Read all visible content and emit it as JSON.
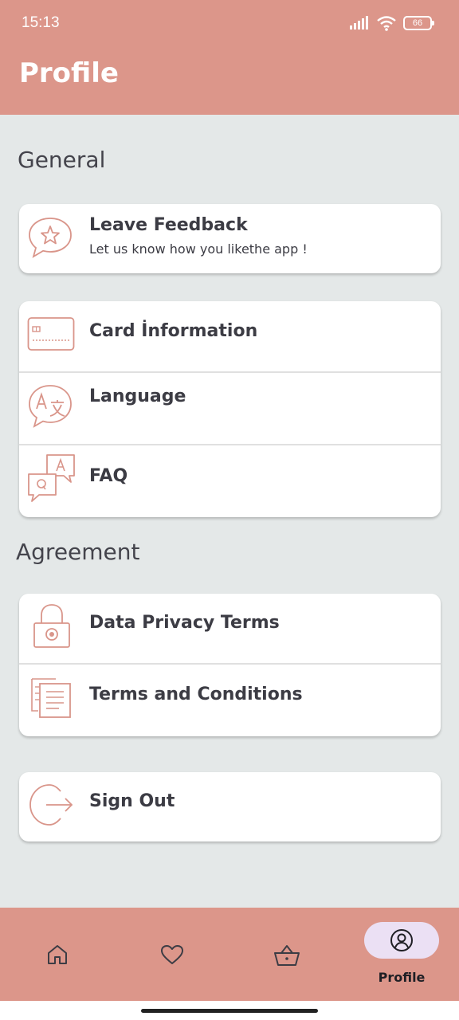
{
  "status_bar": {
    "time": "15:13",
    "battery": "66",
    "icons": [
      "signal-icon",
      "wifi-icon",
      "battery-icon"
    ]
  },
  "header": {
    "title": "Profile",
    "background": "#dc968a"
  },
  "sections": {
    "general": "General",
    "agreement": "Agreement"
  },
  "general_items": {
    "feedback": {
      "title": "Leave Feedback",
      "subtitle": "Let us know how you likethe app !",
      "icon": "feedback-star-icon"
    },
    "card_info": {
      "title": "Card İnformation",
      "icon": "credit-card-icon"
    },
    "language": {
      "title": "Language",
      "icon": "translate-icon"
    },
    "faq": {
      "title": "FAQ",
      "icon": "qa-chat-icon"
    }
  },
  "agreement_items": {
    "privacy": {
      "title": "Data Privacy Terms",
      "icon": "padlock-icon"
    },
    "terms": {
      "title": "Terms and Conditions",
      "icon": "document-icon"
    }
  },
  "sign_out": {
    "title": "Sign Out",
    "icon": "sign-out-icon"
  },
  "bottom_nav": {
    "items": [
      {
        "icon": "home-icon",
        "label": ""
      },
      {
        "icon": "heart-icon",
        "label": ""
      },
      {
        "icon": "basket-icon",
        "label": ""
      },
      {
        "icon": "profile-icon",
        "label": "Profile",
        "active": true
      }
    ]
  },
  "colors": {
    "accent": "#dc968a",
    "icon_stroke": "#d9958a",
    "background": "#e4e8e8",
    "active_pill": "#ebe0f4"
  }
}
